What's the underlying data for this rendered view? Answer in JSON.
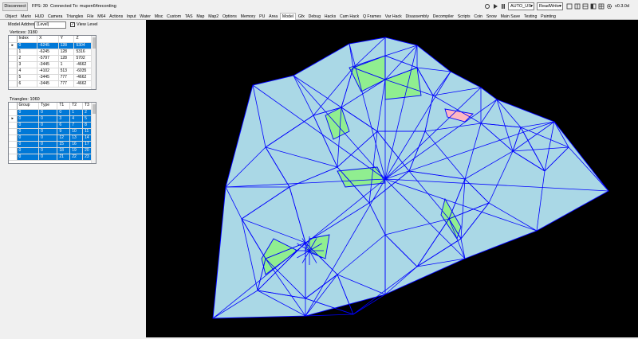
{
  "toolbar": {
    "disconnect_label": "Disconnect",
    "fps_text": "FPS: 30",
    "connected_text": "Connected To: mupen64recording",
    "region_value": "AUTO_US",
    "mode_value": "ReadWrite",
    "version": "v0.3.0d"
  },
  "tabs": [
    "Object",
    "Mario",
    "HUD",
    "Camera",
    "Triangles",
    "File",
    "M64",
    "Actions",
    "Input",
    "Water",
    "Misc",
    "Custom",
    "TAS",
    "Map",
    "Map2",
    "Options",
    "Memory",
    "PU",
    "Area",
    "Model",
    "Gfx",
    "Debug",
    "Hacks",
    "Cam Hack",
    "Q Frames",
    "Var Hack",
    "Disassembly",
    "Decompiler",
    "Scripts",
    "Coin",
    "Snow",
    "Main Save",
    "Testing",
    "Painting"
  ],
  "active_tab": "Model",
  "model": {
    "address_label": "Model Address:",
    "address_value": "(Level)",
    "view_level_label": "View Level",
    "vertices_label": "Vertices: 3180",
    "triangles_label": "Triangles: 1060"
  },
  "vertices": {
    "columns": [
      "Index",
      "X",
      "Y",
      "Z"
    ],
    "rows": [
      [
        "0",
        "-6245",
        "128",
        "5304"
      ],
      [
        "1",
        "-6245",
        "128",
        "5316"
      ],
      [
        "2",
        "-5797",
        "128",
        "5702"
      ],
      [
        "3",
        "-3445",
        "1",
        "-4662"
      ],
      [
        "4",
        "-4102",
        "513",
        "-6035"
      ],
      [
        "5",
        "-3445",
        "777",
        "-4662"
      ],
      [
        "6",
        "-3445",
        "777",
        "-4662"
      ]
    ]
  },
  "triangles": {
    "columns": [
      "Group",
      "Type",
      "T1",
      "T2",
      "T3"
    ],
    "rows": [
      [
        "0",
        "0",
        "0",
        "1",
        "2"
      ],
      [
        "0",
        "0",
        "3",
        "4",
        "5"
      ],
      [
        "0",
        "0",
        "6",
        "7",
        "8"
      ],
      [
        "0",
        "0",
        "9",
        "10",
        "11"
      ],
      [
        "0",
        "0",
        "12",
        "13",
        "14"
      ],
      [
        "0",
        "0",
        "15",
        "16",
        "17"
      ],
      [
        "0",
        "0",
        "18",
        "19",
        "20"
      ],
      [
        "0",
        "0",
        "21",
        "22",
        "23"
      ]
    ]
  },
  "colors": {
    "selection": "#0078d7",
    "mesh_fill": "#aad8e6",
    "mesh_edge": "#0000ff",
    "green_face": "#90ee90",
    "pink_face": "#ffb6c1",
    "background": "#000000"
  }
}
